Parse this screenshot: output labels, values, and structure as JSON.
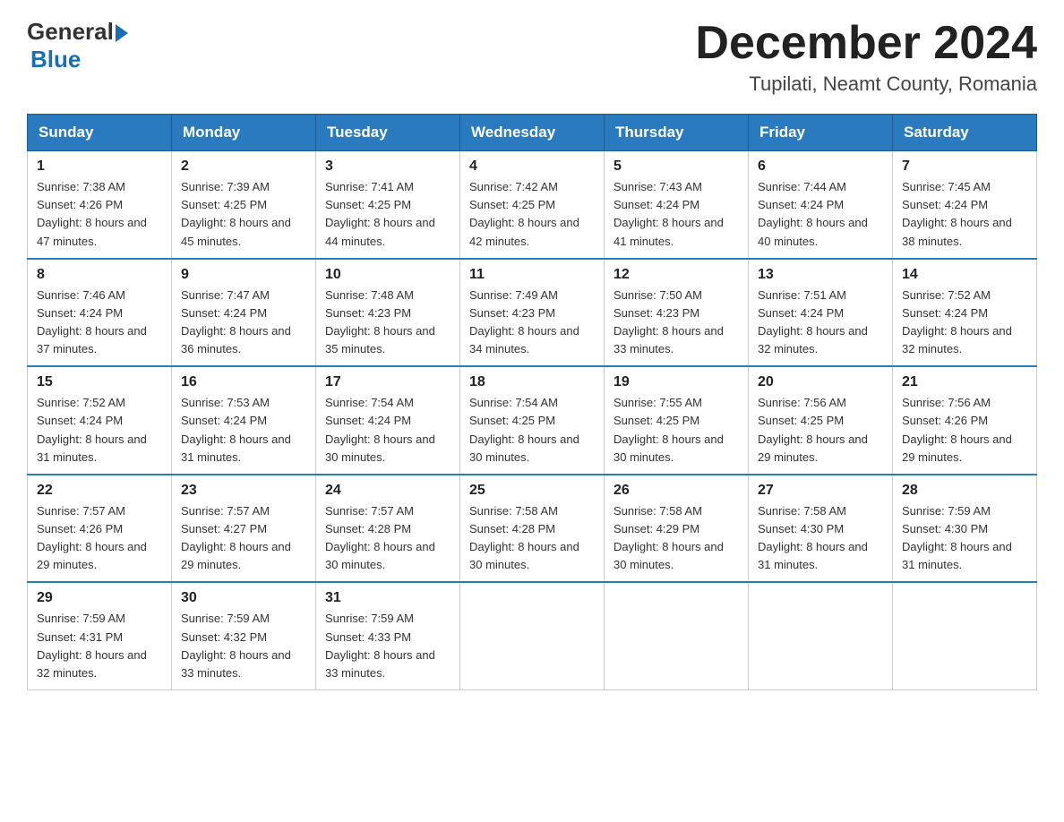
{
  "logo": {
    "general": "General",
    "blue": "Blue"
  },
  "header": {
    "title": "December 2024",
    "subtitle": "Tupilati, Neamt County, Romania"
  },
  "days_of_week": [
    "Sunday",
    "Monday",
    "Tuesday",
    "Wednesday",
    "Thursday",
    "Friday",
    "Saturday"
  ],
  "weeks": [
    [
      {
        "day": "1",
        "sunrise": "7:38 AM",
        "sunset": "4:26 PM",
        "daylight": "8 hours and 47 minutes."
      },
      {
        "day": "2",
        "sunrise": "7:39 AM",
        "sunset": "4:25 PM",
        "daylight": "8 hours and 45 minutes."
      },
      {
        "day": "3",
        "sunrise": "7:41 AM",
        "sunset": "4:25 PM",
        "daylight": "8 hours and 44 minutes."
      },
      {
        "day": "4",
        "sunrise": "7:42 AM",
        "sunset": "4:25 PM",
        "daylight": "8 hours and 42 minutes."
      },
      {
        "day": "5",
        "sunrise": "7:43 AM",
        "sunset": "4:24 PM",
        "daylight": "8 hours and 41 minutes."
      },
      {
        "day": "6",
        "sunrise": "7:44 AM",
        "sunset": "4:24 PM",
        "daylight": "8 hours and 40 minutes."
      },
      {
        "day": "7",
        "sunrise": "7:45 AM",
        "sunset": "4:24 PM",
        "daylight": "8 hours and 38 minutes."
      }
    ],
    [
      {
        "day": "8",
        "sunrise": "7:46 AM",
        "sunset": "4:24 PM",
        "daylight": "8 hours and 37 minutes."
      },
      {
        "day": "9",
        "sunrise": "7:47 AM",
        "sunset": "4:24 PM",
        "daylight": "8 hours and 36 minutes."
      },
      {
        "day": "10",
        "sunrise": "7:48 AM",
        "sunset": "4:23 PM",
        "daylight": "8 hours and 35 minutes."
      },
      {
        "day": "11",
        "sunrise": "7:49 AM",
        "sunset": "4:23 PM",
        "daylight": "8 hours and 34 minutes."
      },
      {
        "day": "12",
        "sunrise": "7:50 AM",
        "sunset": "4:23 PM",
        "daylight": "8 hours and 33 minutes."
      },
      {
        "day": "13",
        "sunrise": "7:51 AM",
        "sunset": "4:24 PM",
        "daylight": "8 hours and 32 minutes."
      },
      {
        "day": "14",
        "sunrise": "7:52 AM",
        "sunset": "4:24 PM",
        "daylight": "8 hours and 32 minutes."
      }
    ],
    [
      {
        "day": "15",
        "sunrise": "7:52 AM",
        "sunset": "4:24 PM",
        "daylight": "8 hours and 31 minutes."
      },
      {
        "day": "16",
        "sunrise": "7:53 AM",
        "sunset": "4:24 PM",
        "daylight": "8 hours and 31 minutes."
      },
      {
        "day": "17",
        "sunrise": "7:54 AM",
        "sunset": "4:24 PM",
        "daylight": "8 hours and 30 minutes."
      },
      {
        "day": "18",
        "sunrise": "7:54 AM",
        "sunset": "4:25 PM",
        "daylight": "8 hours and 30 minutes."
      },
      {
        "day": "19",
        "sunrise": "7:55 AM",
        "sunset": "4:25 PM",
        "daylight": "8 hours and 30 minutes."
      },
      {
        "day": "20",
        "sunrise": "7:56 AM",
        "sunset": "4:25 PM",
        "daylight": "8 hours and 29 minutes."
      },
      {
        "day": "21",
        "sunrise": "7:56 AM",
        "sunset": "4:26 PM",
        "daylight": "8 hours and 29 minutes."
      }
    ],
    [
      {
        "day": "22",
        "sunrise": "7:57 AM",
        "sunset": "4:26 PM",
        "daylight": "8 hours and 29 minutes."
      },
      {
        "day": "23",
        "sunrise": "7:57 AM",
        "sunset": "4:27 PM",
        "daylight": "8 hours and 29 minutes."
      },
      {
        "day": "24",
        "sunrise": "7:57 AM",
        "sunset": "4:28 PM",
        "daylight": "8 hours and 30 minutes."
      },
      {
        "day": "25",
        "sunrise": "7:58 AM",
        "sunset": "4:28 PM",
        "daylight": "8 hours and 30 minutes."
      },
      {
        "day": "26",
        "sunrise": "7:58 AM",
        "sunset": "4:29 PM",
        "daylight": "8 hours and 30 minutes."
      },
      {
        "day": "27",
        "sunrise": "7:58 AM",
        "sunset": "4:30 PM",
        "daylight": "8 hours and 31 minutes."
      },
      {
        "day": "28",
        "sunrise": "7:59 AM",
        "sunset": "4:30 PM",
        "daylight": "8 hours and 31 minutes."
      }
    ],
    [
      {
        "day": "29",
        "sunrise": "7:59 AM",
        "sunset": "4:31 PM",
        "daylight": "8 hours and 32 minutes."
      },
      {
        "day": "30",
        "sunrise": "7:59 AM",
        "sunset": "4:32 PM",
        "daylight": "8 hours and 33 minutes."
      },
      {
        "day": "31",
        "sunrise": "7:59 AM",
        "sunset": "4:33 PM",
        "daylight": "8 hours and 33 minutes."
      },
      null,
      null,
      null,
      null
    ]
  ],
  "labels": {
    "sunrise": "Sunrise:",
    "sunset": "Sunset:",
    "daylight": "Daylight:"
  }
}
